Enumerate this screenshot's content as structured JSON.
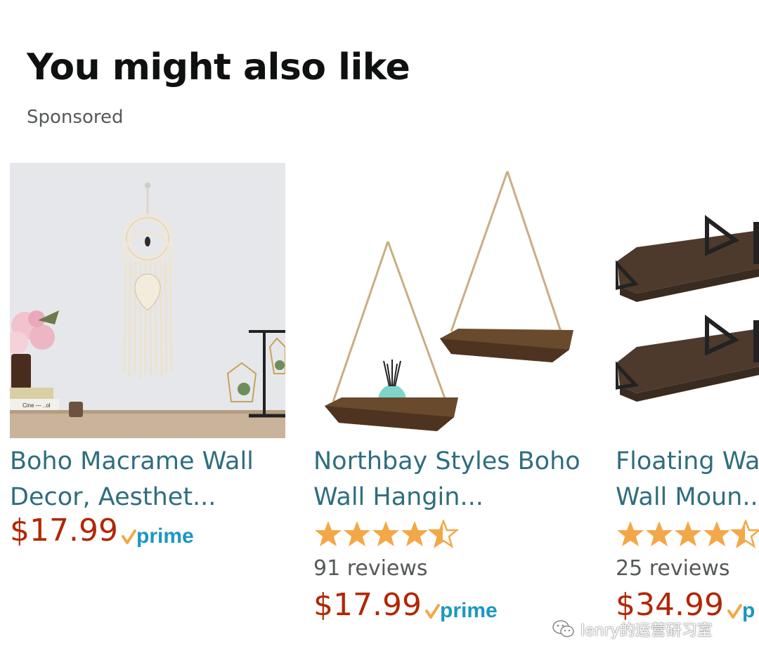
{
  "section": {
    "title": "You might also like",
    "sponsored_label": "Sponsored"
  },
  "products": [
    {
      "title_line1": "Boho Macrame Wall",
      "title_line2": "Decor, Aesthet...",
      "price": "$17.99",
      "prime_label": "prime"
    },
    {
      "title_line1": "Northbay Styles Boho",
      "title_line2": "Wall Hangin...",
      "rating": 4.5,
      "reviews": "91 reviews",
      "price": "$17.99",
      "prime_label": "prime"
    },
    {
      "title_line1": "Floating Wa",
      "title_line2": "Wall Moun...",
      "rating": 4.5,
      "reviews": "25 reviews",
      "price": "$34.99",
      "prime_label": "p"
    }
  ],
  "watermark": {
    "text": "lenry的运营研习室"
  },
  "colors": {
    "link": "#2f6d7f",
    "price": "#b12704",
    "star": "#f3a847",
    "prime_blue": "#1a98c2",
    "prime_check": "#f3a847"
  }
}
